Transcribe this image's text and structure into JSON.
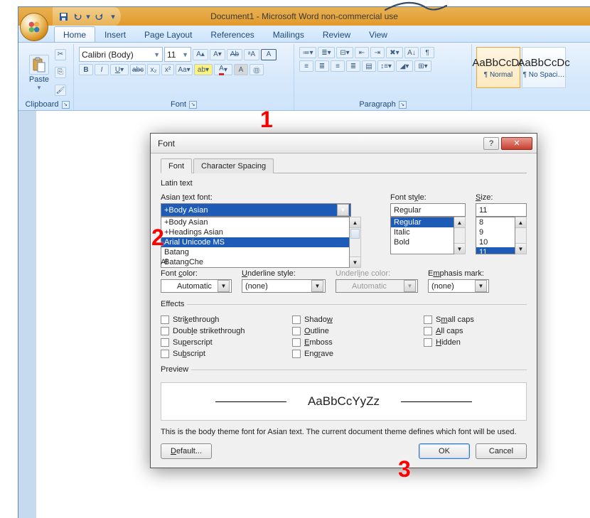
{
  "window": {
    "title": "Document1 - Microsoft Word non-commercial use"
  },
  "tabs": {
    "home": "Home",
    "insert": "Insert",
    "pagelayout": "Page Layout",
    "references": "References",
    "mailings": "Mailings",
    "review": "Review",
    "view": "View"
  },
  "ribbon": {
    "clipboard": {
      "label": "Clipboard",
      "paste": "Paste"
    },
    "font": {
      "label": "Font",
      "fontname": "Calibri (Body)",
      "fontsize": "11"
    },
    "paragraph": {
      "label": "Paragraph"
    },
    "styles": {
      "sample": "AaBbCcDc",
      "normal": "¶ Normal",
      "nospacing": "¶ No Spaci…"
    }
  },
  "dialog": {
    "title": "Font",
    "tabs": {
      "font": "Font",
      "charspacing": "Character Spacing"
    },
    "latin_text": "Latin text",
    "asian_label": "Asian text font:",
    "asian_value": "+Body Asian",
    "asian_options": [
      "+Body Asian",
      "+Headings Asian",
      "Arial Unicode MS",
      "Batang",
      "BatangChe"
    ],
    "fontstyle_label": "Font style:",
    "fontstyle_value": "Regular",
    "fontstyle_options": [
      "Regular",
      "Italic",
      "Bold"
    ],
    "size_label": "Size:",
    "size_value": "11",
    "size_options": [
      "8",
      "9",
      "10",
      "11"
    ],
    "all_prefix": "Al",
    "fontcolor_label": "Font color:",
    "fontcolor_value": "Automatic",
    "underline_label": "Underline style:",
    "underline_value": "(none)",
    "underlinecolor_label": "Underline color:",
    "underlinecolor_value": "Automatic",
    "emphasis_label": "Emphasis mark:",
    "emphasis_value": "(none)",
    "effects_label": "Effects",
    "effects": {
      "strike": "Strikethrough",
      "dstrike": "Double strikethrough",
      "sup": "Superscript",
      "sub": "Subscript",
      "shadow": "Shadow",
      "outline": "Outline",
      "emboss": "Emboss",
      "engrave": "Engrave",
      "smallcaps": "Small caps",
      "allcaps": "All caps",
      "hidden": "Hidden"
    },
    "preview_label": "Preview",
    "preview_text": "AaBbCcYyZz",
    "description": "This is the body theme font for Asian text. The current document theme defines which font will be used.",
    "default_btn": "Default...",
    "ok_btn": "OK",
    "cancel_btn": "Cancel"
  },
  "annotations": {
    "n1": "1",
    "n2": "2",
    "n3": "3"
  }
}
